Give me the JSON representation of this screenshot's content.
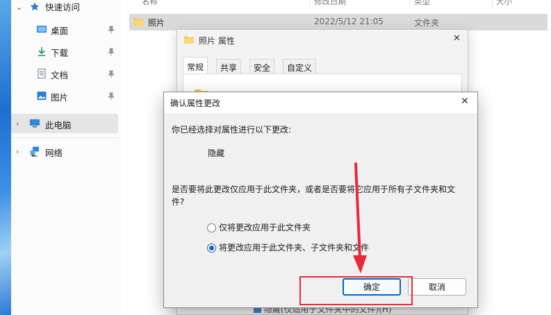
{
  "explorer": {
    "columns": [
      "名称",
      "修改日期",
      "类型",
      "大小"
    ],
    "nav": {
      "quick_access": "快速访问",
      "items": [
        {
          "label": "桌面",
          "icon": "desktop-folder-icon"
        },
        {
          "label": "下载",
          "icon": "download-arrow-icon"
        },
        {
          "label": "文档",
          "icon": "document-icon"
        },
        {
          "label": "图片",
          "icon": "picture-icon"
        }
      ],
      "this_pc": "此电脑",
      "network": "网络"
    },
    "file": {
      "name": "照片",
      "date": "2022/5/12 21:05",
      "type": "文件夹"
    }
  },
  "properties": {
    "title": "照片 属性",
    "tabs": [
      "常规",
      "共享",
      "安全",
      "自定义"
    ],
    "hidden_checkbox_label": "隐藏(仅适用于文件夹中的文件)(H)"
  },
  "dialog": {
    "title": "确认属性更改",
    "intro": "你已经选择对属性进行以下更改:",
    "change": "隐藏",
    "question_line1": "是否要将此更改仅应用于此文件夹，或者是否要将它应用于所有子文件夹和文",
    "question_line2": "件?",
    "option1": "仅将更改应用于此文件夹",
    "option2": "将更改应用于此文件夹、子文件夹和文件",
    "selected_option": 2,
    "ok": "确定",
    "cancel": "取消"
  },
  "colors": {
    "annotation": "#e8293a",
    "accent": "#0067c0"
  }
}
